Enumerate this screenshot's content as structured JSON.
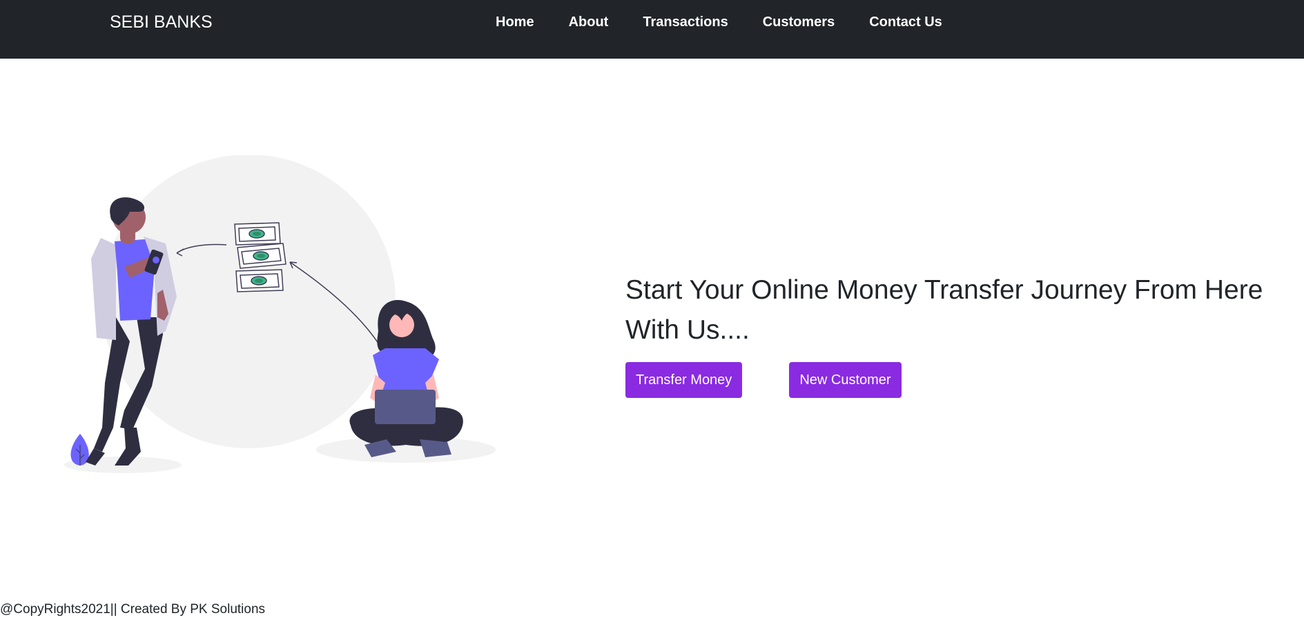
{
  "navbar": {
    "brand": "SEBI BANKS",
    "links": [
      {
        "label": "Home"
      },
      {
        "label": "About"
      },
      {
        "label": "Transactions"
      },
      {
        "label": "Customers"
      },
      {
        "label": "Contact Us"
      }
    ],
    "background_color": "#212529"
  },
  "hero": {
    "heading": "Start Your Online Money Transfer Journey From Here With Us....",
    "buttons": {
      "transfer_money": "Transfer Money",
      "new_customer": "New Customer"
    },
    "button_color": "#8a2be2",
    "illustration": "money-transfer-illustration"
  },
  "footer": {
    "text": "@CopyRights2021|| Created By PK Solutions"
  }
}
